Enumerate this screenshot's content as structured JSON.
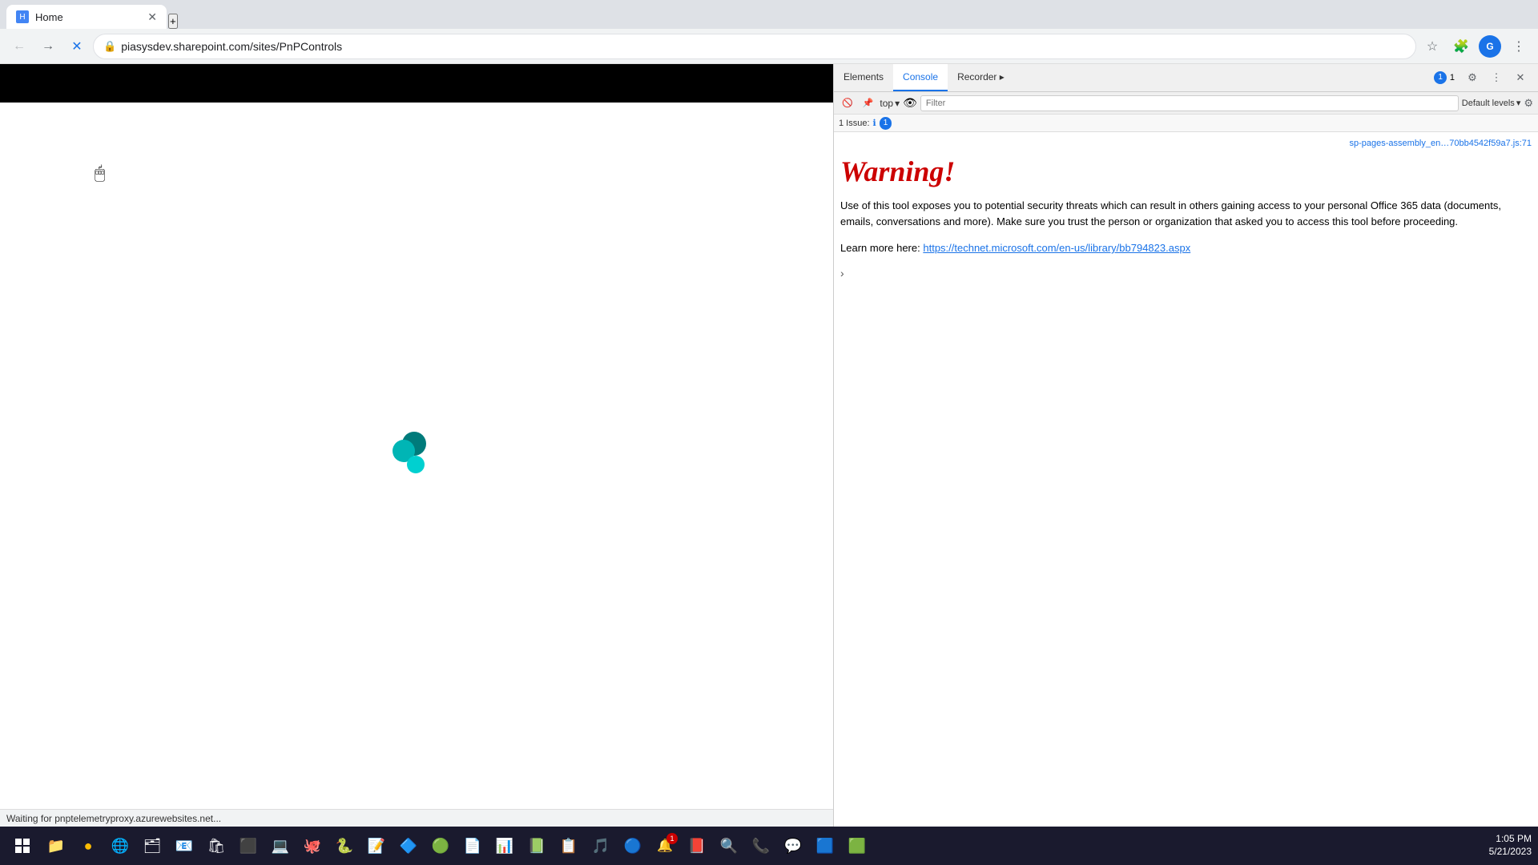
{
  "browser": {
    "tab": {
      "title": "Home",
      "favicon": "H"
    },
    "url": "piasysdev.sharepoint.com/sites/PnPControls",
    "loading": true
  },
  "devtools": {
    "tabs": [
      "Elements",
      "Console",
      "Recorder",
      ""
    ],
    "active_tab": "Console",
    "top_label": "top",
    "filter_placeholder": "Filter",
    "default_levels": "Default levels",
    "issues_count": "1 Issue:",
    "issues_badge": "1",
    "file_link": "sp-pages-assembly_en…70bb4542f59a7.js:71",
    "warning_heading": "Warning!",
    "warning_body": "Use of this tool exposes you to potential security threats which can result in others gaining access to your personal Office 365 data (documents, emails, conversations and more). Make sure you trust the person or organization that asked you to access this tool before proceeding.",
    "learn_more_prefix": "Learn more here:",
    "learn_more_url": "https://technet.microsoft.com/en-us/library/bb794823.aspx"
  },
  "status_bar": {
    "text": "Waiting for pnptelemetryproxy.azurewebsites.net..."
  },
  "taskbar": {
    "time": "1:05 PM",
    "date": "5/21/2023",
    "notification_count": "1"
  }
}
